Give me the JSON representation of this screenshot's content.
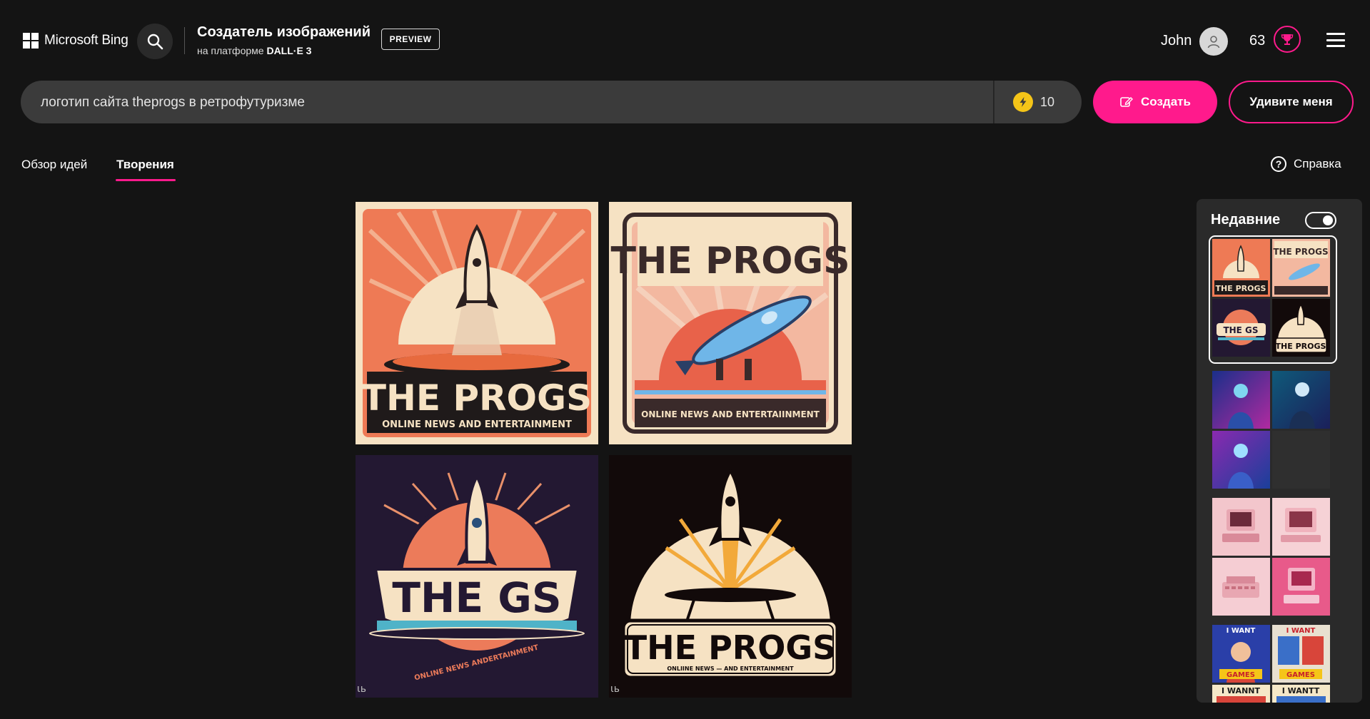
{
  "header": {
    "brand": "Microsoft Bing",
    "title": "Создатель изображений",
    "subtitle_prefix": "на платформе ",
    "subtitle_model": "DALL·E 3",
    "badge": "PREVIEW",
    "user_name": "John",
    "points": "63"
  },
  "prompt": {
    "value": "логотип сайта theprogs в ретрофутуризме",
    "boosts": "10",
    "create_label": "Создать",
    "surprise_label": "Удивите меня"
  },
  "tabs": [
    {
      "label": "Обзор идей",
      "active": false
    },
    {
      "label": "Творения",
      "active": true
    }
  ],
  "help_label": "Справка",
  "results": [
    {
      "title": "THE PROGS",
      "tagline": "ONLINE  NEWS  AND  ENTERTAINMENT",
      "mark": ""
    },
    {
      "title": "THE PROGS",
      "tagline": "ONLINE NEWS AND ENTERTAIINMENT",
      "mark": ""
    },
    {
      "title": "THE GS",
      "tagline": "ONLINE NEWS ANDERTAINMENT",
      "mark": "ɩь"
    },
    {
      "title": "THE PROGS",
      "tagline": "ONLIINE NEWS — AND ENTERTAINMENT",
      "mark": "ɩь"
    }
  ],
  "recent": {
    "title": "Недавние",
    "toggle_on": true,
    "groups": [
      {
        "theme": "retro-logos",
        "selected": true,
        "mini_titles": [
          "THE PROGS",
          "THE PROGS",
          "THE GS",
          "THE PROGS"
        ]
      },
      {
        "theme": "cyberpunk-portraits",
        "selected": false,
        "count": 3
      },
      {
        "theme": "pink-retro-computers",
        "selected": false,
        "count": 4
      },
      {
        "theme": "game-posters",
        "selected": false,
        "mini_titles": [
          "I WANT",
          "I WANT",
          "GAMES",
          "GAMES",
          "I WANNT",
          "I WANTT"
        ]
      }
    ]
  },
  "colors": {
    "background": "#141414",
    "accent": "#ff1a8c",
    "bar": "#3b3b3b",
    "panel": "#2a2a2a"
  }
}
